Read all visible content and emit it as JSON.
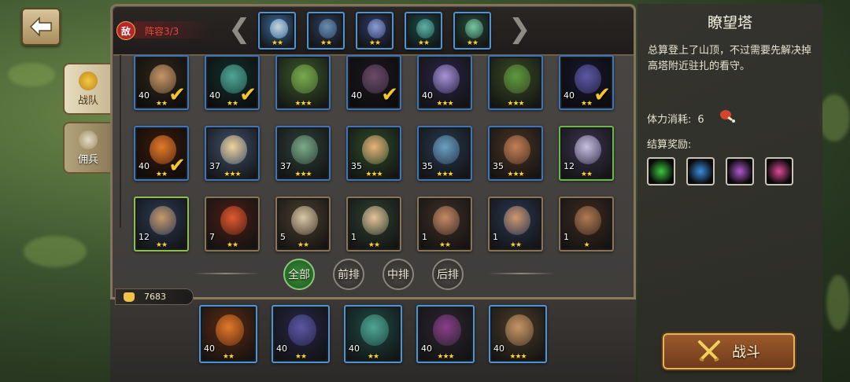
{
  "header": {
    "enemy_badge": "敌",
    "lineup_label": "阵容3/3",
    "prev_arrow": "❮",
    "next_arrow": "❯"
  },
  "side_tabs": [
    {
      "label": "战队",
      "active": true
    },
    {
      "label": "佣兵",
      "active": false
    }
  ],
  "enemy_team": [
    {
      "stars": "★★",
      "art": "#3a6a9a",
      "face": "#c7d6e0"
    },
    {
      "stars": "★★",
      "art": "#2b3e5c",
      "face": "#6b8fb0"
    },
    {
      "stars": "★★",
      "art": "#2d3a64",
      "face": "#8c9cd6"
    },
    {
      "stars": "★★",
      "art": "#1d4a4a",
      "face": "#5fb3a5"
    },
    {
      "stars": "★★",
      "art": "#264a3a",
      "face": "#79c6a2"
    }
  ],
  "hero_rows": [
    [
      {
        "level": "40",
        "stars": "★★",
        "selected": true,
        "art": "#4b3c2a",
        "face": "#c79566",
        "frame": "#3e76b8"
      },
      {
        "level": "40",
        "stars": "★★",
        "selected": true,
        "art": "#1f4a44",
        "face": "#4fa594",
        "frame": "#3e76b8"
      },
      {
        "level": "",
        "stars": "★★★",
        "selected": false,
        "art": "#3c5a2c",
        "face": "#7aaa4c",
        "frame": "#3e76b8"
      },
      {
        "level": "40",
        "stars": "",
        "selected": true,
        "art": "#2c2530",
        "face": "#6d4a6a",
        "frame": "#3e76b8"
      },
      {
        "level": "40",
        "stars": "★★★",
        "selected": false,
        "art": "#2a2446",
        "face": "#a793d6",
        "frame": "#3e76b8"
      },
      {
        "level": "",
        "stars": "★★★",
        "selected": false,
        "art": "#3a4a26",
        "face": "#5d9a3c",
        "frame": "#3e76b8"
      },
      {
        "level": "40",
        "stars": "★★",
        "selected": true,
        "art": "#262546",
        "face": "#5c57a4",
        "frame": "#3e76b8"
      }
    ],
    [
      {
        "level": "40",
        "stars": "★★",
        "selected": true,
        "art": "#5a2a12",
        "face": "#e07a2a",
        "frame": "#3e76b8"
      },
      {
        "level": "37",
        "stars": "★★★",
        "selected": false,
        "art": "#40506a",
        "face": "#f0d29a",
        "frame": "#3e76b8"
      },
      {
        "level": "37",
        "stars": "★★★",
        "selected": false,
        "art": "#2e4038",
        "face": "#7cab8a",
        "frame": "#3e76b8"
      },
      {
        "level": "35",
        "stars": "★★★",
        "selected": false,
        "art": "#2e4a2a",
        "face": "#e8b27a",
        "frame": "#3e76b8"
      },
      {
        "level": "35",
        "stars": "★★★",
        "selected": false,
        "art": "#28384e",
        "face": "#6aa0c0",
        "frame": "#3e76b8"
      },
      {
        "level": "35",
        "stars": "★★★",
        "selected": false,
        "art": "#4a3324",
        "face": "#c47f55",
        "frame": "#3e76b8"
      },
      {
        "level": "12",
        "stars": "★★",
        "selected": false,
        "art": "#3a3450",
        "face": "#c8c0e0",
        "frame": "#6ab84a"
      }
    ],
    [
      {
        "level": "12",
        "stars": "★★",
        "selected": false,
        "art": "#2c3a52",
        "face": "#c89a6a",
        "frame": "#8ac050"
      },
      {
        "level": "7",
        "stars": "★★",
        "selected": false,
        "art": "#4a1e16",
        "face": "#e05a2e",
        "frame": "#8a7456"
      },
      {
        "level": "5",
        "stars": "★★",
        "selected": false,
        "art": "#4a3e2e",
        "face": "#d8c8a8",
        "frame": "#8a7456"
      },
      {
        "level": "1",
        "stars": "★★",
        "selected": false,
        "art": "#2e4030",
        "face": "#e6c39a",
        "frame": "#8a7456"
      },
      {
        "level": "1",
        "stars": "★★",
        "selected": false,
        "art": "#3e2e26",
        "face": "#c58a64",
        "frame": "#8a7456"
      },
      {
        "level": "1",
        "stars": "★★",
        "selected": false,
        "art": "#2a3650",
        "face": "#d09870",
        "frame": "#8a7456"
      },
      {
        "level": "1",
        "stars": "★",
        "selected": false,
        "art": "#3e2a20",
        "face": "#b07a52",
        "frame": "#8a7456"
      }
    ]
  ],
  "filters": [
    "全部",
    "前排",
    "中排",
    "后排"
  ],
  "power": "7683",
  "team_slots": [
    {
      "level": "40",
      "stars": "★★",
      "art": "#5a2a12",
      "face": "#e07a2a"
    },
    {
      "level": "40",
      "stars": "★★",
      "art": "#262546",
      "face": "#5c57a4"
    },
    {
      "level": "40",
      "stars": "★★",
      "art": "#1f4a44",
      "face": "#4fa594"
    },
    {
      "level": "40",
      "stars": "★★★",
      "art": "#2c2530",
      "face": "#8a3e8a"
    },
    {
      "level": "40",
      "stars": "★★★",
      "art": "#4b3c2a",
      "face": "#c79566"
    }
  ],
  "tower": {
    "title": "瞭望塔",
    "description": "总算登上了山顶，不过需要先解决掉高塔附近驻扎的看守。",
    "stamina_label": "体力消耗:",
    "stamina_value": "6",
    "reward_label": "结算奖励:",
    "rewards": [
      {
        "icon": "green-orb-icon",
        "color": "#3cc83c"
      },
      {
        "icon": "blue-eye-orb-icon",
        "color": "#3a8ee0"
      },
      {
        "icon": "scroll-icon",
        "color": "#b05ad0"
      },
      {
        "icon": "rainbow-orb-icon",
        "color": "#e04a9a"
      }
    ]
  },
  "battle_button": "战斗"
}
